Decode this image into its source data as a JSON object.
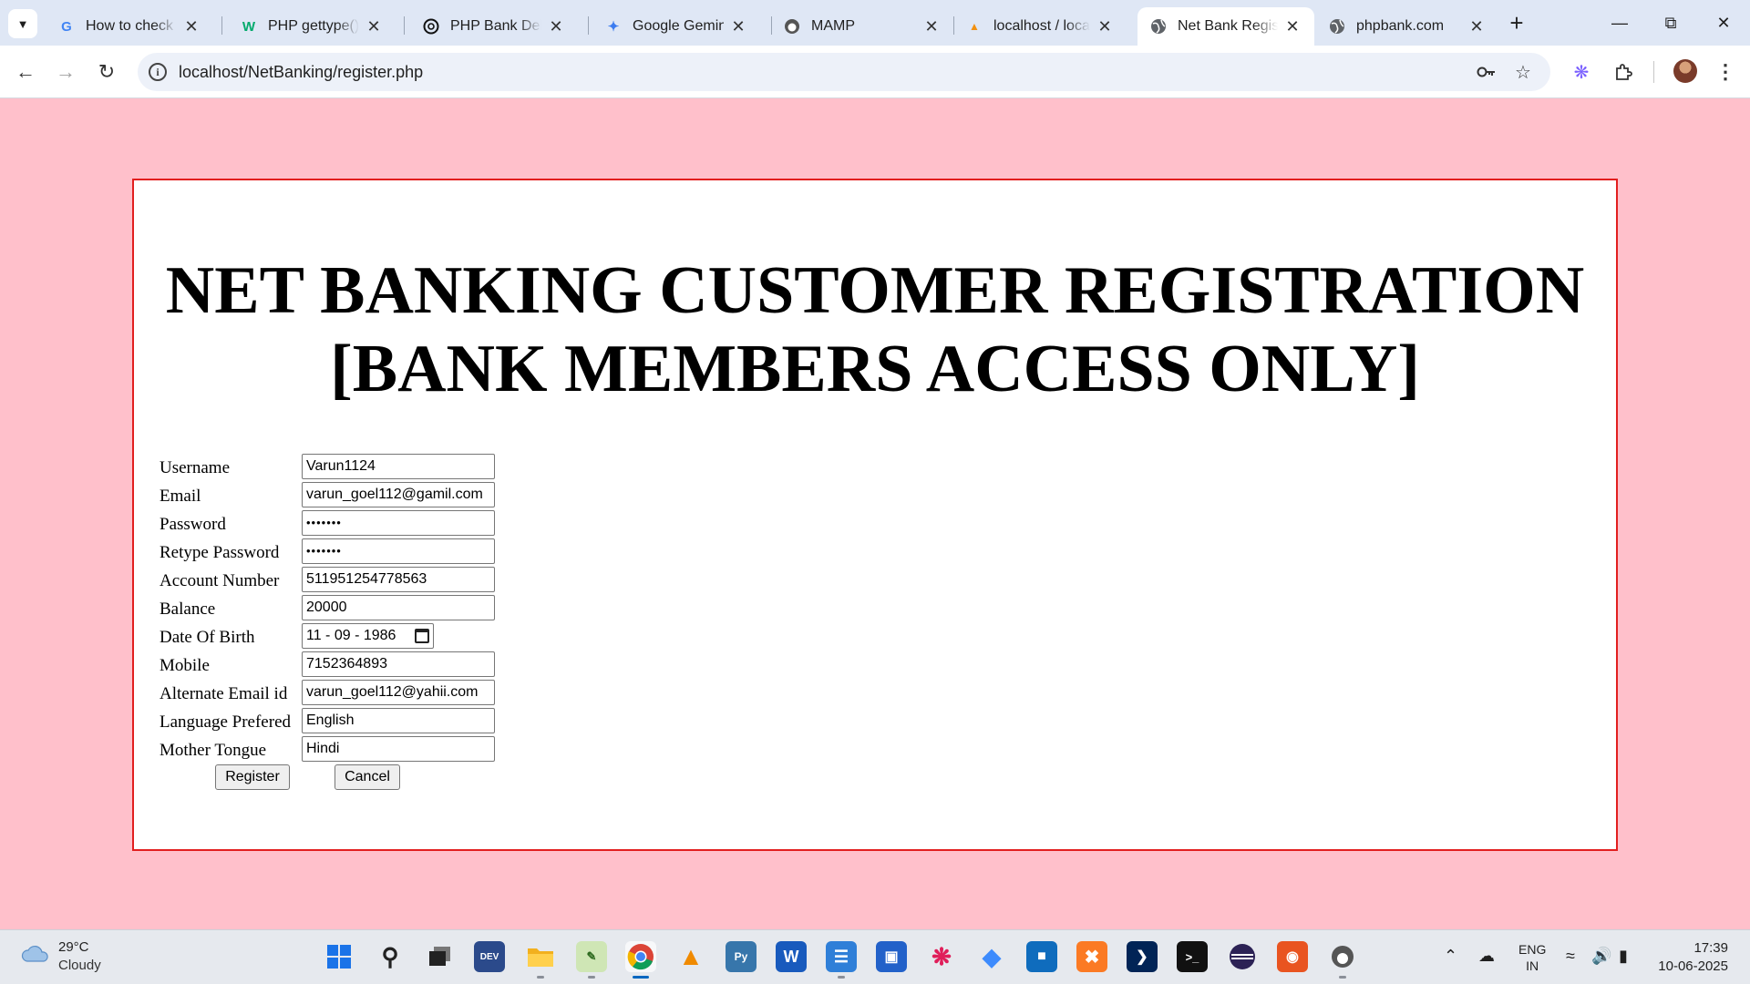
{
  "browser": {
    "tabs": [
      {
        "title": "How to check da",
        "icon": "google-icon",
        "active": false
      },
      {
        "title": "PHP gettype() Fu",
        "icon": "w3schools-icon",
        "active": false
      },
      {
        "title": "PHP Bank Debit",
        "icon": "chatgpt-icon",
        "active": false
      },
      {
        "title": "Google Gemini",
        "icon": "gemini-icon",
        "active": false
      },
      {
        "title": "MAMP",
        "icon": "mamp-icon",
        "active": false
      },
      {
        "title": "localhost / locall",
        "icon": "phpmyadmin-icon",
        "active": false
      },
      {
        "title": "Net Bank Registe",
        "icon": "globe-icon",
        "active": true
      },
      {
        "title": "phpbank.com",
        "icon": "globe-icon",
        "active": false
      }
    ],
    "url": "localhost/NetBanking/register.php"
  },
  "page": {
    "heading_line1": "NET BANKING CUSTOMER REGISTRATION",
    "heading_line2": "[BANK MEMBERS ACCESS ONLY]",
    "fields": [
      {
        "label": "Username",
        "value": "Varun1124",
        "type": "text"
      },
      {
        "label": "Email",
        "value": "varun_goel112@gamil.com",
        "type": "text"
      },
      {
        "label": "Password",
        "value": "•••••••",
        "type": "password"
      },
      {
        "label": "Retype Password",
        "value": "•••••••",
        "type": "password"
      },
      {
        "label": "Account Number",
        "value": "511951254778563",
        "type": "text"
      },
      {
        "label": "Balance",
        "value": "20000",
        "type": "text"
      },
      {
        "label": "Date Of Birth",
        "value": "11 - 09 - 1986",
        "type": "date"
      },
      {
        "label": "Mobile",
        "value": "7152364893",
        "type": "text"
      },
      {
        "label": "Alternate Email id",
        "value": "varun_goel112@yahii.com",
        "type": "text"
      },
      {
        "label": "Language Prefered",
        "value": "English",
        "type": "text"
      },
      {
        "label": "Mother Tongue",
        "value": "Hindi",
        "type": "text"
      }
    ],
    "register_label": "Register",
    "cancel_label": "Cancel"
  },
  "taskbar": {
    "weather_temp": "29°C",
    "weather_condition": "Cloudy",
    "lang_line1": "ENG",
    "lang_line2": "IN",
    "time": "17:39",
    "date": "10-06-2025"
  },
  "colors": {
    "page_background": "#ffc0cb",
    "form_border": "#e21f1f"
  }
}
